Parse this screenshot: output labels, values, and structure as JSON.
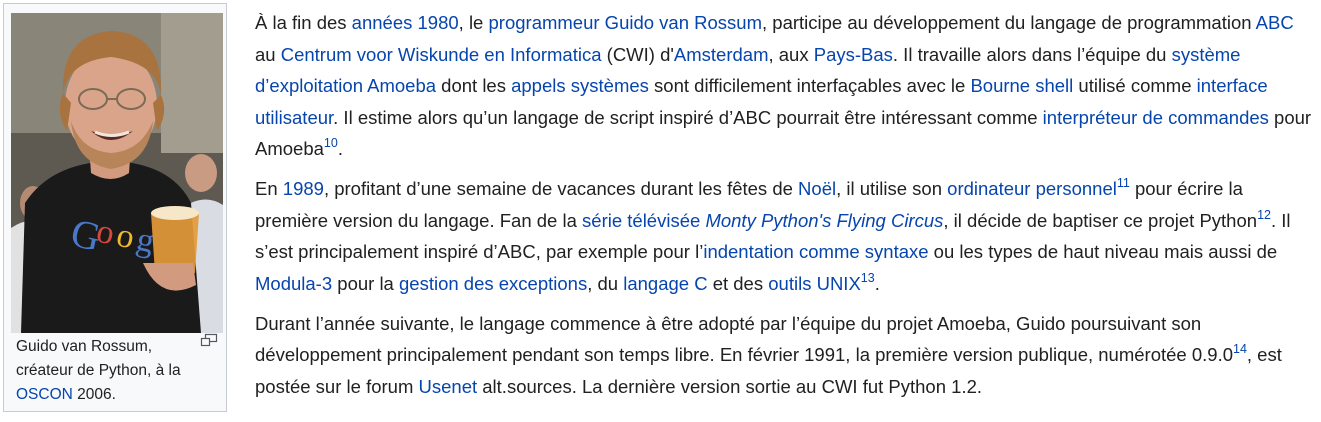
{
  "figure": {
    "image_alt": "Guido van Rossum à l'OSCON 2006",
    "shirt_text": "Google",
    "caption": {
      "line1": "Guido van Rossum,",
      "line2": "créateur de Python, à la",
      "link": "OSCON",
      "after_link": " 2006."
    },
    "icons": {
      "enlarge": "magnify-icon"
    }
  },
  "paragraphs": [
    {
      "segments": [
        {
          "text": "À la fin des "
        },
        {
          "text": "années 1980",
          "link": true
        },
        {
          "text": ", le "
        },
        {
          "text": "programmeur Guido van Rossum",
          "link": true
        },
        {
          "text": ", participe au développement du langage de programmation "
        },
        {
          "text": "ABC",
          "link": true
        },
        {
          "text": " au "
        },
        {
          "text": "Centrum voor Wiskunde en Informatica",
          "link": true
        },
        {
          "text": " (CWI) d'"
        },
        {
          "text": "Amsterdam",
          "link": true
        },
        {
          "text": ", aux "
        },
        {
          "text": "Pays-Bas",
          "link": true
        },
        {
          "text": ". Il travaille alors dans l’équipe du "
        },
        {
          "text": "système d’exploitation Amoeba",
          "link": true
        },
        {
          "text": " dont les "
        },
        {
          "text": "appels systèmes",
          "link": true
        },
        {
          "text": " sont difficilement interfaçables avec le "
        },
        {
          "text": "Bourne shell",
          "link": true
        },
        {
          "text": " utilisé comme "
        },
        {
          "text": "interface utilisateur",
          "link": true
        },
        {
          "text": ". Il estime alors qu’un langage de script inspiré d’ABC pourrait être intéressant comme "
        },
        {
          "text": "interpréteur de commandes",
          "link": true
        },
        {
          "text": " pour Amoeba"
        },
        {
          "text": "10",
          "ref": true
        },
        {
          "text": "."
        }
      ]
    },
    {
      "segments": [
        {
          "text": "En "
        },
        {
          "text": "1989",
          "link": true
        },
        {
          "text": ", profitant d’une semaine de vacances durant les fêtes de "
        },
        {
          "text": "Noël",
          "link": true
        },
        {
          "text": ", il utilise son "
        },
        {
          "text": "ordinateur personnel",
          "link": true
        },
        {
          "text": "11",
          "ref": true
        },
        {
          "text": " pour écrire la première version du langage. Fan de la "
        },
        {
          "text": "série télévisée ",
          "link": true
        },
        {
          "text": "Monty Python's Flying Circus",
          "link": true,
          "italic": true
        },
        {
          "text": ", il décide de baptiser ce projet Python"
        },
        {
          "text": "12",
          "ref": true
        },
        {
          "text": ". Il s’est principalement inspiré d’ABC, par exemple pour l’"
        },
        {
          "text": "indentation comme syntaxe",
          "link": true
        },
        {
          "text": " ou les types de haut niveau mais aussi de "
        },
        {
          "text": "Modula-3",
          "link": true
        },
        {
          "text": " pour la "
        },
        {
          "text": "gestion des exceptions",
          "link": true
        },
        {
          "text": ", du "
        },
        {
          "text": "langage C",
          "link": true
        },
        {
          "text": " et des "
        },
        {
          "text": "outils UNIX",
          "link": true
        },
        {
          "text": "13",
          "ref": true
        },
        {
          "text": "."
        }
      ]
    },
    {
      "segments": [
        {
          "text": "Durant l’année suivante, le langage commence à être adopté par l’équipe du projet Amoeba, Guido poursuivant son développement principalement pendant son temps libre. En février 1991, la première version publique, numérotée 0.9.0"
        },
        {
          "text": "14",
          "ref": true
        },
        {
          "text": ", est postée sur le forum "
        },
        {
          "text": "Usenet",
          "link": true
        },
        {
          "text": " alt.sources. La dernière version sortie au CWI fut Python 1.2."
        }
      ]
    }
  ]
}
